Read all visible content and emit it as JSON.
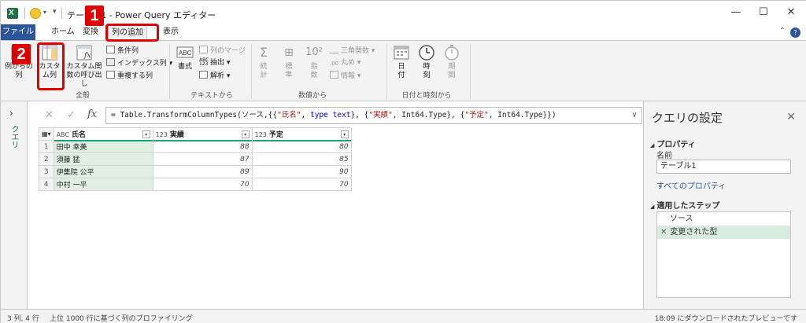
{
  "window": {
    "title": "テーブル1 - Power Query エディター",
    "minimize": "—",
    "maximize": "☐",
    "close": "✕"
  },
  "menu": {
    "file": "ファイル",
    "tabs": [
      "ホーム",
      "変換",
      "列の追加",
      "表示"
    ],
    "active_tab": "列の追加"
  },
  "ribbon": {
    "general": {
      "example_col": "例からの列",
      "custom_col": "カスタム列",
      "invoke_fn": "カスタム関数の呼び出し",
      "conditional": "条件列",
      "index": "インデックス列",
      "duplicate": "重複する列",
      "label": "全般"
    },
    "text": {
      "format": "書式",
      "merge": "列のマージ",
      "extract": "抽出",
      "parse": "解析",
      "label": "テキストから"
    },
    "number": {
      "stats": "統計",
      "standard": "標準",
      "scientific": "指数",
      "trig": "三角関数",
      "round": "丸め",
      "info": "情報",
      "label": "数値から"
    },
    "datetime": {
      "date": "日付",
      "time": "時刻",
      "duration": "期間",
      "label": "日付と時刻から"
    }
  },
  "annotations": {
    "step1": "1",
    "step2": "2"
  },
  "nav": {
    "queries_label": "クエリ"
  },
  "formula": {
    "prefix": "= Table.TransformColumnTypes(ソース,{{",
    "s1": "\"氏名\"",
    "mid1": ", ",
    "kw": "type text",
    "mid2": "}, {",
    "s2": "\"実績\"",
    "mid3": ", Int64.Type}, {",
    "s3": "\"予定\"",
    "suffix": ", Int64.Type}})"
  },
  "table": {
    "columns": [
      {
        "type": "ABC",
        "name": "氏名"
      },
      {
        "type": "123",
        "name": "実績"
      },
      {
        "type": "123",
        "name": "予定"
      }
    ],
    "rows": [
      {
        "n": "1",
        "name": "田中 幸美",
        "actual": "88",
        "plan": "80"
      },
      {
        "n": "2",
        "name": "須藤 猛",
        "actual": "87",
        "plan": "85"
      },
      {
        "n": "3",
        "name": "伊集院 公平",
        "actual": "89",
        "plan": "90"
      },
      {
        "n": "4",
        "name": "中村 一平",
        "actual": "70",
        "plan": "70"
      }
    ]
  },
  "settings": {
    "title": "クエリの設定",
    "properties": "プロパティ",
    "name_label": "名前",
    "name_value": "テーブル1",
    "all_props": "すべてのプロパティ",
    "applied_steps": "適用したステップ",
    "steps": [
      "ソース",
      "変更された型"
    ]
  },
  "status": {
    "counts": "3 列, 4 行",
    "profiling": "上位 1000 行に基づく列のプロファイリング",
    "preview": "18:09 にダウンロードされたプレビューです"
  },
  "colors": {
    "file_tab": "#2b579a",
    "accent_green": "#1e7145",
    "annotation_red": "#e00000"
  }
}
